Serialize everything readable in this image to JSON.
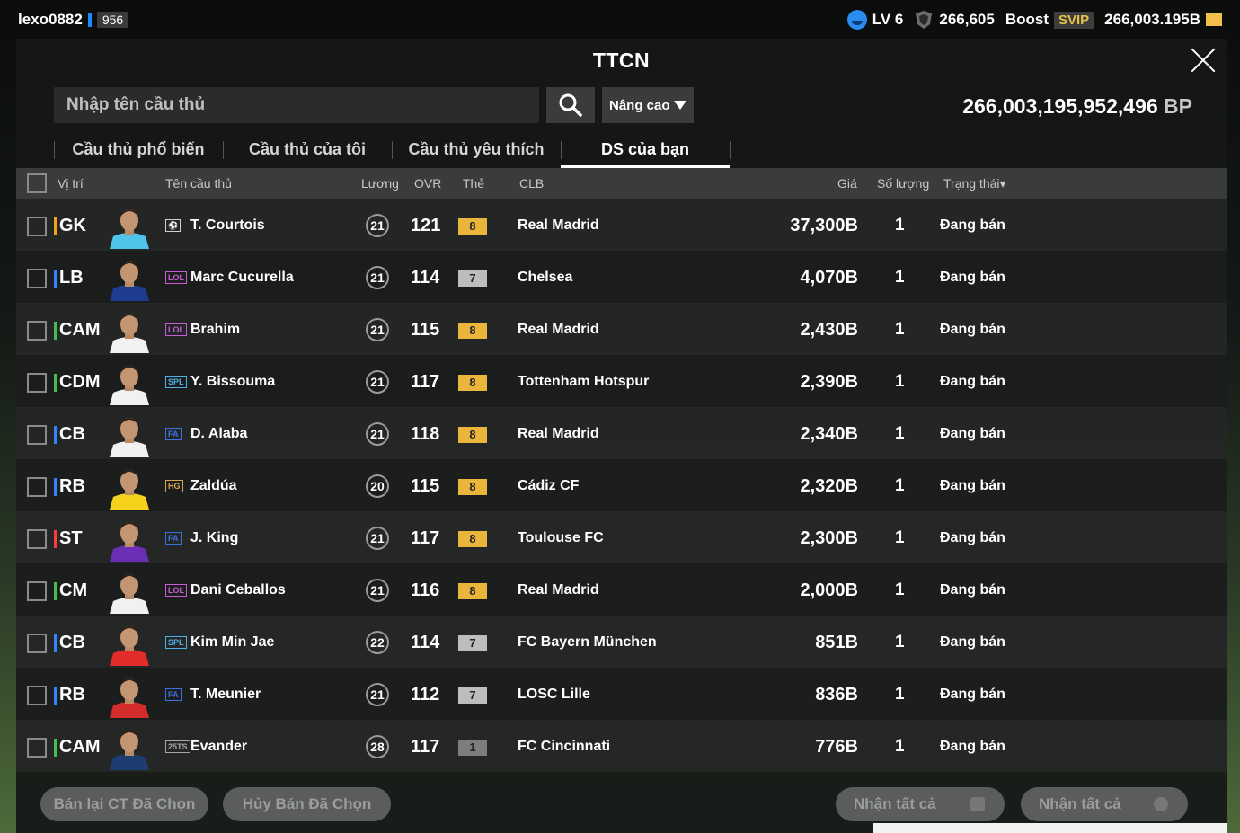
{
  "topbar": {
    "username": "lexo0882",
    "user_level": "956",
    "lv": "LV 6",
    "coins": "266,605",
    "boost": "Boost",
    "svip": "SVIP",
    "bp_short": "266,003.195B"
  },
  "panel": {
    "title": "TTCN",
    "search_placeholder": "Nhập tên cầu thủ",
    "advanced": "Nâng cao",
    "bp_amount": "266,003,195,952,496",
    "bp_unit": "BP"
  },
  "tabs": [
    {
      "label": "Cầu thủ phổ biến",
      "active": false
    },
    {
      "label": "Cầu thủ của tôi",
      "active": false
    },
    {
      "label": "Cầu thủ yêu thích",
      "active": false
    },
    {
      "label": "DS của bạn",
      "active": true
    }
  ],
  "columns": {
    "position": "Vị trí",
    "name": "Tên cầu thủ",
    "wage": "Lương",
    "ovr": "OVR",
    "grade": "Thẻ",
    "club": "CLB",
    "price": "Giá",
    "qty": "Số lượng",
    "status": "Trạng thái▾"
  },
  "players": [
    {
      "pos": "GK",
      "pos_color": "#f2a21b",
      "season": "⚽",
      "season_color": "#cfcfcf",
      "name": "T. Courtois",
      "wage": "21",
      "ovr": "121",
      "grade": "8",
      "grade_color": "#e9b53b",
      "club": "Real Madrid",
      "price": "37,300B",
      "qty": "1",
      "status": "Đang bán",
      "kit": "#4fc3ea"
    },
    {
      "pos": "LB",
      "pos_color": "#2f86ff",
      "season": "LOL",
      "season_color": "#c85bd8",
      "name": "Marc Cucurella",
      "wage": "21",
      "ovr": "114",
      "grade": "7",
      "grade_color": "#bdbdbd",
      "club": "Chelsea",
      "price": "4,070B",
      "qty": "1",
      "status": "Đang bán",
      "kit": "#1d3c8f"
    },
    {
      "pos": "CAM",
      "pos_color": "#3fbf55",
      "season": "LOL",
      "season_color": "#c85bd8",
      "name": "Brahim",
      "wage": "21",
      "ovr": "115",
      "grade": "8",
      "grade_color": "#e9b53b",
      "club": "Real Madrid",
      "price": "2,430B",
      "qty": "1",
      "status": "Đang bán",
      "kit": "#f1f1f1"
    },
    {
      "pos": "CDM",
      "pos_color": "#3fbf55",
      "season": "SPL",
      "season_color": "#4fb0e8",
      "name": "Y. Bissouma",
      "wage": "21",
      "ovr": "117",
      "grade": "8",
      "grade_color": "#e9b53b",
      "club": "Tottenham Hotspur",
      "price": "2,390B",
      "qty": "1",
      "status": "Đang bán",
      "kit": "#f1f1f1"
    },
    {
      "pos": "CB",
      "pos_color": "#2f86ff",
      "season": "FA",
      "season_color": "#3c6fe0",
      "name": "D. Alaba",
      "wage": "21",
      "ovr": "118",
      "grade": "8",
      "grade_color": "#e9b53b",
      "club": "Real Madrid",
      "price": "2,340B",
      "qty": "1",
      "status": "Đang bán",
      "kit": "#f1f1f1"
    },
    {
      "pos": "RB",
      "pos_color": "#2f86ff",
      "season": "HG",
      "season_color": "#d9a94b",
      "name": "Zaldúa",
      "wage": "20",
      "ovr": "115",
      "grade": "8",
      "grade_color": "#e9b53b",
      "club": "Cádiz CF",
      "price": "2,320B",
      "qty": "1",
      "status": "Đang bán",
      "kit": "#f5d21c"
    },
    {
      "pos": "ST",
      "pos_color": "#ff3b3b",
      "season": "FA",
      "season_color": "#3c6fe0",
      "name": "J. King",
      "wage": "21",
      "ovr": "117",
      "grade": "8",
      "grade_color": "#e9b53b",
      "club": "Toulouse FC",
      "price": "2,300B",
      "qty": "1",
      "status": "Đang bán",
      "kit": "#6a2fb5"
    },
    {
      "pos": "CM",
      "pos_color": "#3fbf55",
      "season": "LOL",
      "season_color": "#c85bd8",
      "name": "Dani Ceballos",
      "wage": "21",
      "ovr": "116",
      "grade": "8",
      "grade_color": "#e9b53b",
      "club": "Real Madrid",
      "price": "2,000B",
      "qty": "1",
      "status": "Đang bán",
      "kit": "#f1f1f1"
    },
    {
      "pos": "CB",
      "pos_color": "#2f86ff",
      "season": "SPL",
      "season_color": "#4fb0e8",
      "name": "Kim Min Jae",
      "wage": "22",
      "ovr": "114",
      "grade": "7",
      "grade_color": "#bdbdbd",
      "club": "FC Bayern München",
      "price": "851B",
      "qty": "1",
      "status": "Đang bán",
      "kit": "#e32b2b"
    },
    {
      "pos": "RB",
      "pos_color": "#2f86ff",
      "season": "FA",
      "season_color": "#3c6fe0",
      "name": "T. Meunier",
      "wage": "21",
      "ovr": "112",
      "grade": "7",
      "grade_color": "#bdbdbd",
      "club": "LOSC Lille",
      "price": "836B",
      "qty": "1",
      "status": "Đang bán",
      "kit": "#d22c2c"
    },
    {
      "pos": "CAM",
      "pos_color": "#3fbf55",
      "season": "25TS",
      "season_color": "#a8a8a8",
      "name": "Evander",
      "wage": "28",
      "ovr": "117",
      "grade": "1",
      "grade_color": "#7d7d7d",
      "club": "FC Cincinnati",
      "price": "776B",
      "qty": "1",
      "status": "Đang bán",
      "kit": "#1d3c6f"
    }
  ],
  "bottom": {
    "resell": "Bán lại CT Đã Chọn",
    "cancel": "Hủy Bán Đã Chọn",
    "claim_all_1": "Nhận tất cả",
    "claim_all_2": "Nhận tất cả"
  }
}
